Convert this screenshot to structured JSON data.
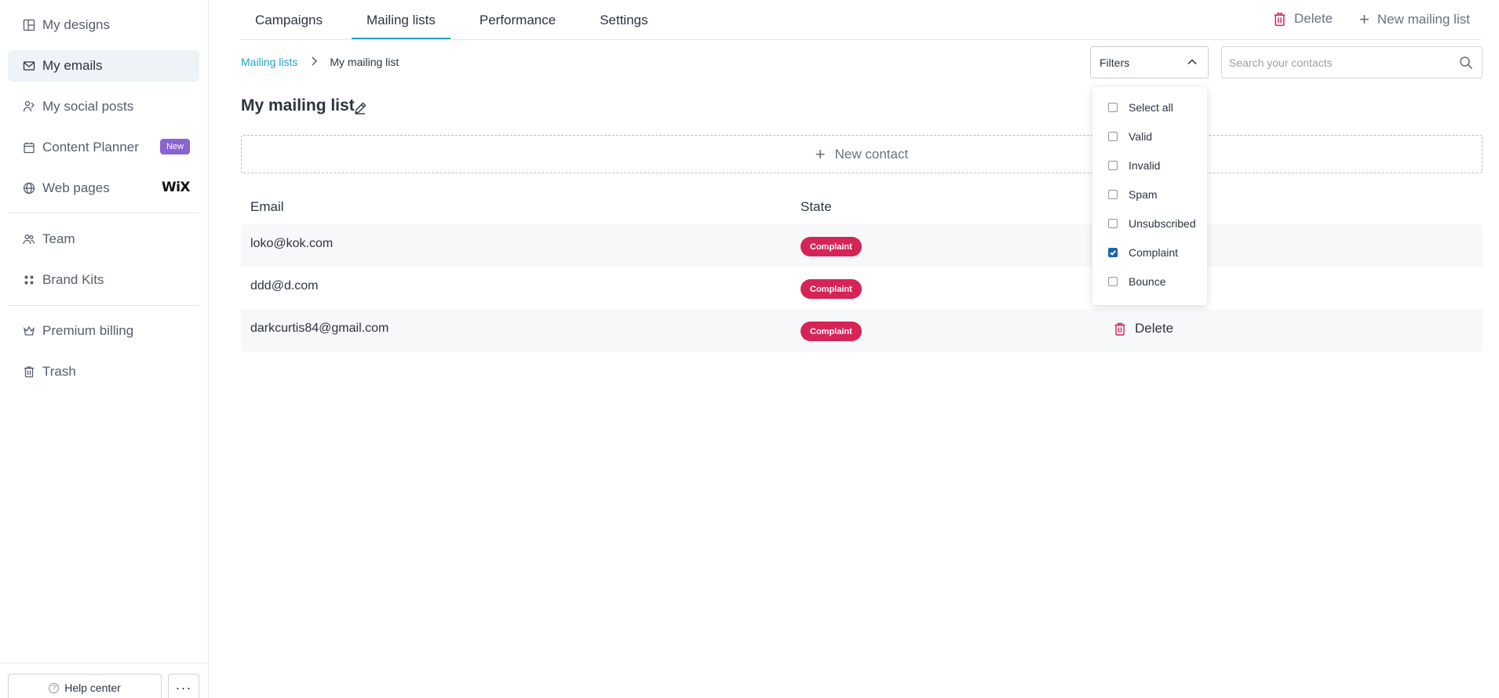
{
  "sidebar": {
    "items": [
      {
        "label": "My designs",
        "icon": "designs-icon"
      },
      {
        "label": "My emails",
        "icon": "envelope-icon"
      },
      {
        "label": "My social posts",
        "icon": "social-icon"
      },
      {
        "label": "Content Planner",
        "icon": "calendar-icon",
        "badge": "New"
      },
      {
        "label": "Web pages",
        "icon": "globe-icon",
        "logo": "WiX"
      },
      {
        "label": "Team",
        "icon": "team-icon"
      },
      {
        "label": "Brand Kits",
        "icon": "brand-kit-icon"
      },
      {
        "label": "Premium billing",
        "icon": "crown-icon"
      },
      {
        "label": "Trash",
        "icon": "trash-icon"
      }
    ],
    "help_label": "Help center",
    "more_label": "···"
  },
  "tabs": [
    {
      "label": "Campaigns"
    },
    {
      "label": "Mailing lists",
      "active": true
    },
    {
      "label": "Performance"
    },
    {
      "label": "Settings"
    }
  ],
  "header_actions": {
    "delete_label": "Delete",
    "new_list_label": "New mailing list"
  },
  "breadcrumb": {
    "parent": "Mailing lists",
    "current": "My mailing list"
  },
  "filters": {
    "label": "Filters",
    "options": [
      {
        "label": "Select all",
        "checked": false
      },
      {
        "label": "Valid",
        "checked": false
      },
      {
        "label": "Invalid",
        "checked": false
      },
      {
        "label": "Spam",
        "checked": false
      },
      {
        "label": "Unsubscribed",
        "checked": false
      },
      {
        "label": "Complaint",
        "checked": true
      },
      {
        "label": "Bounce",
        "checked": false
      }
    ]
  },
  "search": {
    "placeholder": "Search your contacts",
    "value": ""
  },
  "page_title": "My mailing list",
  "new_contact_label": "New contact",
  "table": {
    "columns": [
      "Email",
      "State"
    ],
    "rows": [
      {
        "email": "loko@kok.com",
        "state": "Complaint"
      },
      {
        "email": "ddd@d.com",
        "state": "Complaint"
      },
      {
        "email": "darkcurtis84@gmail.com",
        "state": "Complaint",
        "action": "Delete"
      }
    ]
  },
  "colors": {
    "accent": "#23a4c7",
    "complaint": "#d62457",
    "new_badge": "#8a63d2",
    "delete": "#d62457"
  }
}
